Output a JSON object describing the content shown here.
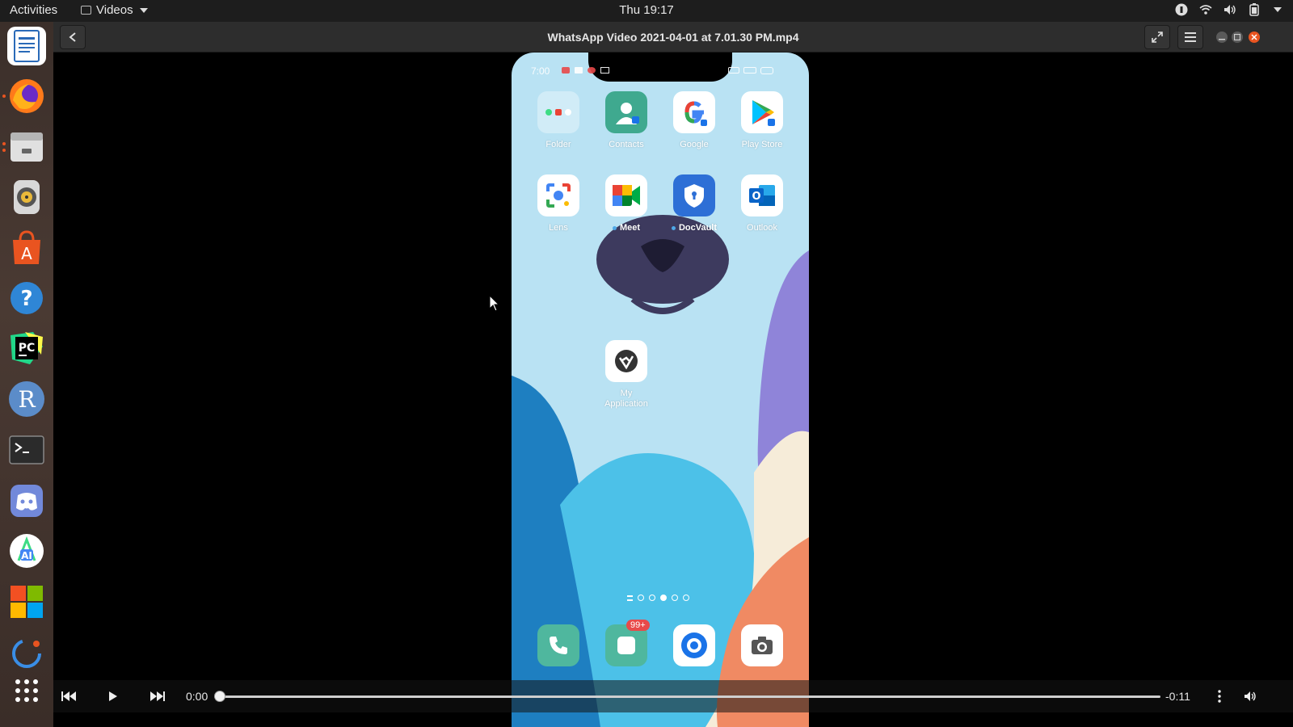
{
  "topbar": {
    "activities": "Activities",
    "app_name": "Videos",
    "clock": "Thu 19:17"
  },
  "window": {
    "title": "WhatsApp Video 2021-04-01 at 7.01.30 PM.mp4"
  },
  "phone": {
    "status_time": "7:00",
    "apps": [
      {
        "label": "Folder"
      },
      {
        "label": "Contacts"
      },
      {
        "label": "Google"
      },
      {
        "label": "Play Store"
      },
      {
        "label": "Lens"
      },
      {
        "label": "Meet"
      },
      {
        "label": "DocVault"
      },
      {
        "label": "Outlook"
      },
      {
        "label": "My\nApplication"
      }
    ],
    "messages_badge": "99+"
  },
  "player": {
    "current_time": "0:00",
    "remaining_time": "-0:11",
    "progress": 0.0
  },
  "colors": {
    "ubuntu_orange": "#e95420",
    "phone_wallpaper": "#b9e2f3"
  }
}
